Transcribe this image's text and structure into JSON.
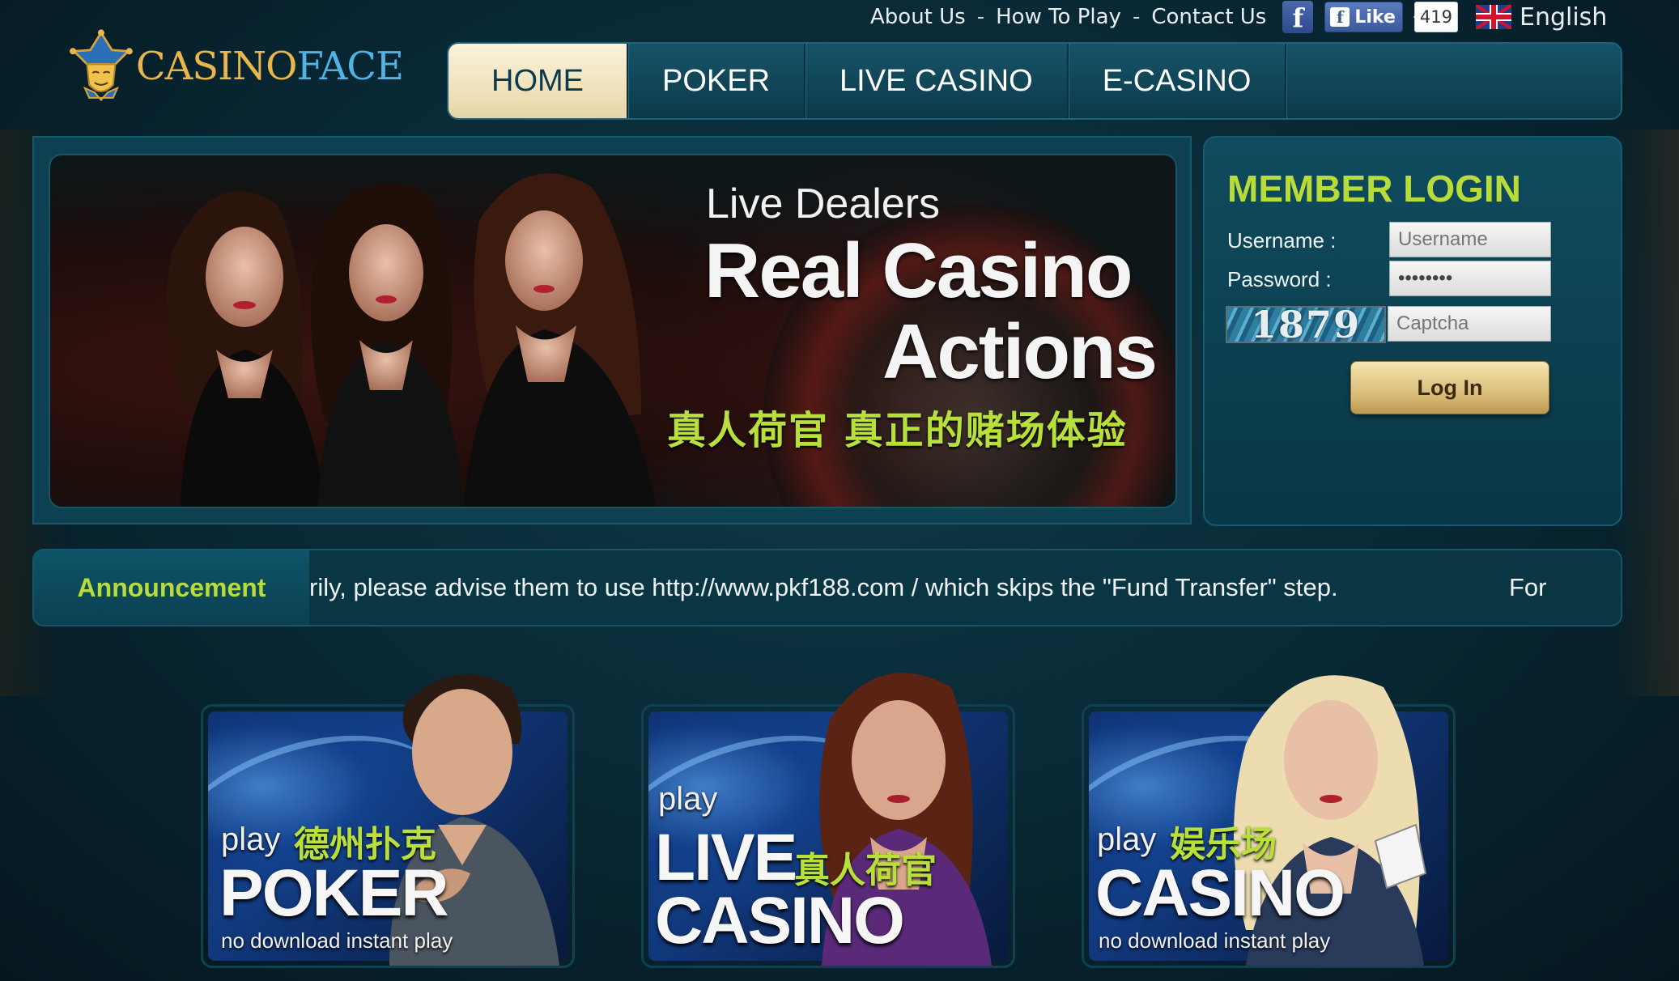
{
  "top_links": {
    "about": "About Us",
    "how_to_play": "How To Play",
    "contact": "Contact Us",
    "separator": "-",
    "fb_icon": "f",
    "fb_like_label": "Like",
    "fb_like_count": "419",
    "language": "English"
  },
  "logo": {
    "part1": "CASINO",
    "part2": "FACE"
  },
  "nav": {
    "home": "HOME",
    "poker": "POKER",
    "live_casino": "LIVE CASINO",
    "e_casino": "E-CASINO"
  },
  "banner": {
    "line1": "Live Dealers",
    "line2": "Real Casino",
    "line3": "Actions",
    "line_cn": "真人荷官  真正的赌场体验"
  },
  "login": {
    "title": "MEMBER LOGIN",
    "username_label": "Username :",
    "password_label": "Password :",
    "username_placeholder": "Username",
    "password_value": "••••••••",
    "captcha_code": "1879",
    "captcha_placeholder": "Captcha",
    "submit": "Log In"
  },
  "announcement": {
    "label": "Announcement",
    "text": "rily, please advise them to use http://www.pkf188.com / which skips the \"Fund Transfer\" step.",
    "trailing": "For"
  },
  "tiles": [
    {
      "play": "play",
      "cn": "德州扑克",
      "title": "POKER",
      "sub": "no download instant play"
    },
    {
      "play": "play",
      "title1": "LIVE",
      "cn": "真人荷官",
      "title2": "CASINO"
    },
    {
      "play": "play",
      "cn": "娱乐场",
      "title": "CASINO",
      "sub": "no download instant play"
    }
  ],
  "colors": {
    "accent_green": "#b9dc3a",
    "background": "#082733",
    "nav_active": "#f3e8c4",
    "login_button": "#d6b771"
  }
}
